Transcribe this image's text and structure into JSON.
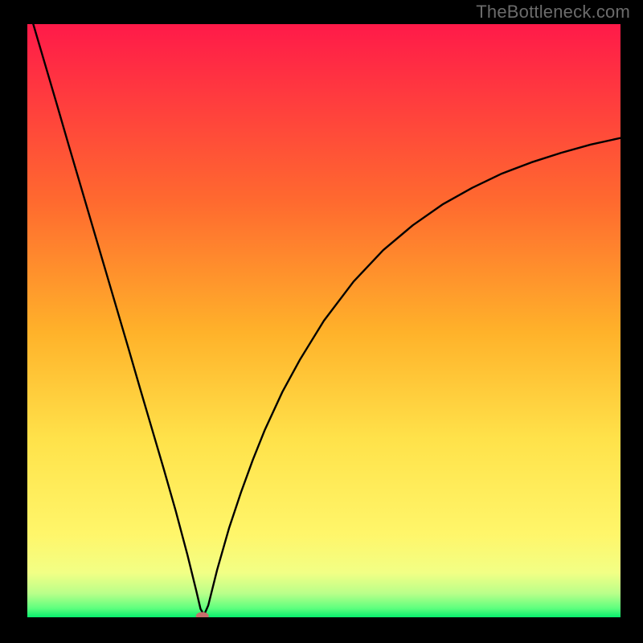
{
  "watermark": "TheBottleneck.com",
  "chart_data": {
    "type": "line",
    "title": "",
    "xlabel": "",
    "ylabel": "",
    "xlim": [
      0,
      100
    ],
    "ylim": [
      0,
      100
    ],
    "grid": false,
    "axes_visible": false,
    "background_gradient": {
      "top_color": "#ff1a49",
      "mid_upper_color": "#ff8a2a",
      "mid_color": "#ffd02a",
      "mid_lower_color": "#fff04a",
      "band_color": "#f7ff7a",
      "bottom_color": "#06ef6d"
    },
    "series": [
      {
        "name": "bottleneck-curve",
        "color": "#000000",
        "x": [
          1,
          3,
          5,
          7,
          9,
          11,
          13,
          15,
          17,
          19,
          21,
          23,
          25,
          27,
          28.5,
          29.2,
          29.8,
          30.5,
          32,
          34,
          36,
          38,
          40,
          43,
          46,
          50,
          55,
          60,
          65,
          70,
          75,
          80,
          85,
          90,
          95,
          100
        ],
        "y": [
          100,
          93.2,
          86.4,
          79.5,
          72.7,
          65.9,
          59.1,
          52.3,
          45.5,
          38.6,
          31.8,
          25.0,
          18.0,
          10.5,
          4.4,
          1.4,
          0.4,
          2.0,
          8.0,
          15.0,
          21.0,
          26.5,
          31.5,
          38.0,
          43.5,
          50.0,
          56.6,
          61.9,
          66.1,
          69.6,
          72.4,
          74.8,
          76.7,
          78.3,
          79.7,
          80.8
        ]
      }
    ],
    "marker": {
      "name": "optimal-point",
      "x": 29.5,
      "y": 0.2,
      "color": "#c76e6b",
      "shape": "ellipse"
    }
  }
}
